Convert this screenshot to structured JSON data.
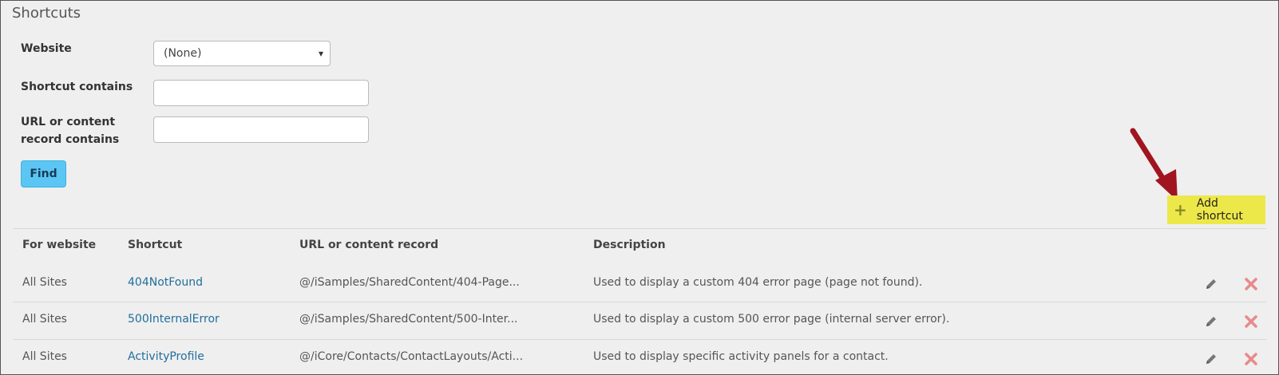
{
  "page": {
    "title": "Shortcuts"
  },
  "filters": {
    "website_label": "Website",
    "website_selected": "(None)",
    "shortcut_label": "Shortcut contains",
    "shortcut_value": "",
    "url_label_line1": "URL or content",
    "url_label_line2": "record contains",
    "url_value": "",
    "find_label": "Find"
  },
  "actions": {
    "add_label": "Add shortcut"
  },
  "table": {
    "headers": [
      "For website",
      "Shortcut",
      "URL or content record",
      "Description"
    ],
    "rows": [
      {
        "website": "All Sites",
        "shortcut": "404NotFound",
        "url": "@/iSamples/SharedContent/404-Page...",
        "description": "Used to display a custom 404 error page (page not found)."
      },
      {
        "website": "All Sites",
        "shortcut": "500InternalError",
        "url": "@/iSamples/SharedContent/500-Inter...",
        "description": "Used to display a custom 500 error page (internal server error)."
      },
      {
        "website": "All Sites",
        "shortcut": "ActivityProfile",
        "url": "@/iCore/Contacts/ContactLayouts/Acti...",
        "description": "Used to display specific activity panels for a contact."
      }
    ]
  },
  "colors": {
    "find_button": "#5bc6f4",
    "add_highlight": "#ede849",
    "link": "#1f6f9c",
    "delete_icon": "#e88a8a",
    "arrow": "#a0151f"
  }
}
